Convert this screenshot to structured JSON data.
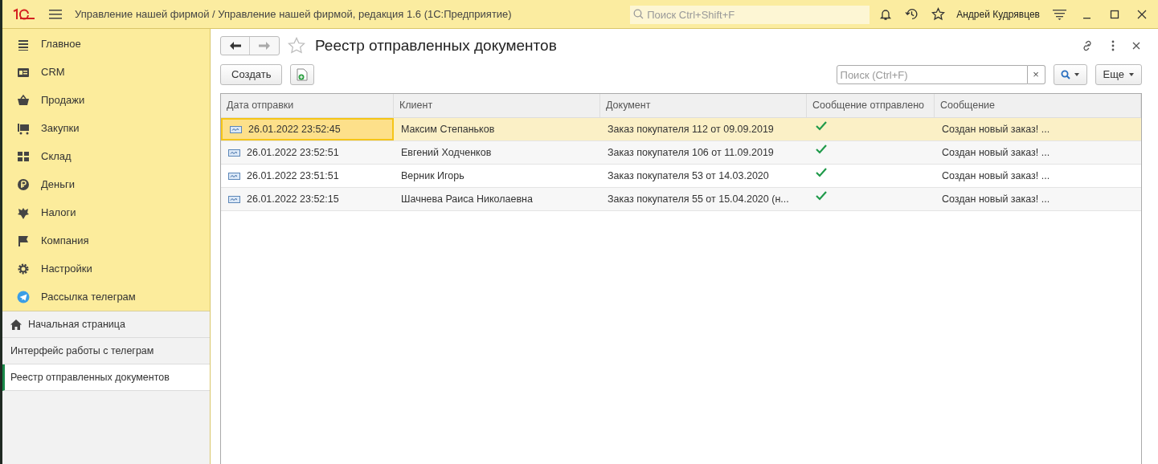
{
  "titlebar": {
    "title": "Управление нашей фирмой / Управление нашей фирмой, редакция 1.6  (1С:Предприятие)",
    "search_placeholder": "Поиск Ctrl+Shift+F",
    "user": "Андрей Кудрявцев"
  },
  "sections": [
    {
      "label": "Главное"
    },
    {
      "label": "CRM"
    },
    {
      "label": "Продажи"
    },
    {
      "label": "Закупки"
    },
    {
      "label": "Склад"
    },
    {
      "label": "Деньги"
    },
    {
      "label": "Налоги"
    },
    {
      "label": "Компания"
    },
    {
      "label": "Настройки"
    },
    {
      "label": "Рассылка телеграм"
    }
  ],
  "open_windows": [
    {
      "kind": "home",
      "label": "Начальная страница",
      "selected": false
    },
    {
      "kind": "form",
      "label": "Интерфейс работы с телеграм",
      "selected": false
    },
    {
      "kind": "form",
      "label": "Реестр отправленных документов",
      "selected": true
    }
  ],
  "form": {
    "title": "Реестр отправленных документов",
    "create_button": "Создать",
    "search_placeholder": "Поиск (Ctrl+F)",
    "clear": "×",
    "more_button": "Еще"
  },
  "table": {
    "columns": [
      "Дата отправки",
      "Клиент",
      "Документ",
      "Сообщение отправлено",
      "Сообщение"
    ],
    "rows": [
      {
        "date": "26.01.2022 23:52:45",
        "client": "Максим Степаньков",
        "document": "Заказ покупателя 112 от 09.09.2019",
        "sent": true,
        "message": "Создан новый заказ! ...",
        "selected": true
      },
      {
        "date": "26.01.2022 23:52:51",
        "client": "Евгений Ходченков",
        "document": "Заказ покупателя 106 от 11.09.2019",
        "sent": true,
        "message": "Создан новый заказ! ...",
        "selected": false
      },
      {
        "date": "26.01.2022 23:51:51",
        "client": "Верник Игорь",
        "document": "Заказ покупателя 53 от 14.03.2020",
        "sent": true,
        "message": "Создан новый заказ! ...",
        "selected": false
      },
      {
        "date": "26.01.2022 23:52:15",
        "client": "Шачнева Раиса Николаевна",
        "document": "Заказ покупателя 55 от 15.04.2020 (н...",
        "sent": true,
        "message": "Создан новый заказ! ...",
        "selected": false
      }
    ]
  }
}
